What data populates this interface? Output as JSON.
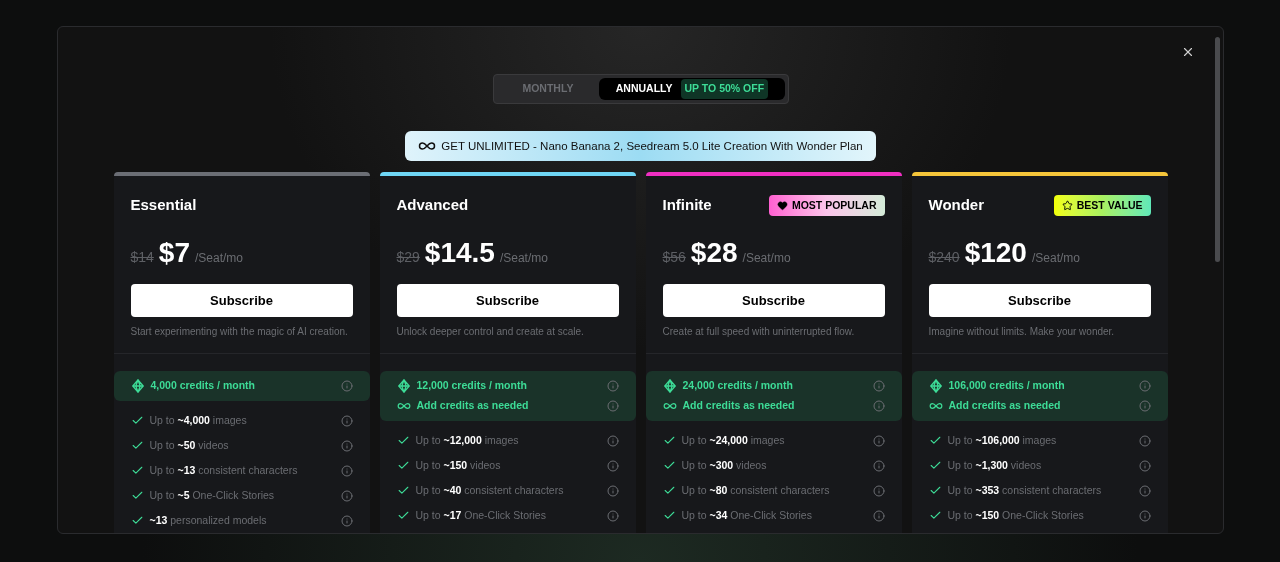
{
  "billing_toggle": {
    "options": [
      {
        "label": "MONTHLY",
        "selected": false
      },
      {
        "label": "ANNUALLY",
        "selected": true,
        "badge": "UP TO 50% OFF"
      }
    ]
  },
  "banner": {
    "text": "GET UNLIMITED - Nano Banana 2, Seedream 5.0 Lite Creation With Wonder Plan"
  },
  "plans": [
    {
      "name": "Essential",
      "color": "#6b6e75",
      "old_price": "$14",
      "price": "$7",
      "unit": "/Seat/mo",
      "button": "Subscribe",
      "description": "Start experimenting with the magic of AI creation.",
      "credits": [
        {
          "kind": "diamond",
          "text": "4,000 credits / month"
        }
      ],
      "features": [
        "Up to **~4,000** images",
        "Up to **~50** videos",
        "Up to **~13** consistent characters",
        "Up to **~5** One-Click Stories",
        "**~13** personalized models"
      ]
    },
    {
      "name": "Advanced",
      "color": "#6fd6f5",
      "old_price": "$29",
      "price": "$14.5",
      "unit": "/Seat/mo",
      "button": "Subscribe",
      "description": "Unlock deeper control and create at scale.",
      "credits": [
        {
          "kind": "diamond",
          "text": "12,000 credits / month"
        },
        {
          "kind": "infinity",
          "text": "Add credits as needed"
        }
      ],
      "features": [
        "Up to **~12,000** images",
        "Up to **~150** videos",
        "Up to **~40** consistent characters",
        "Up to **~17** One-Click Stories"
      ]
    },
    {
      "name": "Infinite",
      "color": "#f02fc2",
      "old_price": "$56",
      "price": "$28",
      "unit": "/Seat/mo",
      "button": "Subscribe",
      "description": "Create at full speed with uninterrupted flow.",
      "badge": {
        "kind": "heart",
        "text": "MOST POPULAR"
      },
      "credits": [
        {
          "kind": "diamond",
          "text": "24,000 credits / month"
        },
        {
          "kind": "infinity",
          "text": "Add credits as needed"
        }
      ],
      "features": [
        "Up to **~24,000** images",
        "Up to **~300** videos",
        "Up to **~80** consistent characters",
        "Up to **~34** One-Click Stories"
      ]
    },
    {
      "name": "Wonder",
      "color": "#f5c53a",
      "old_price": "$240",
      "price": "$120",
      "unit": "/Seat/mo",
      "button": "Subscribe",
      "description": "Imagine without limits. Make your wonder.",
      "badge": {
        "kind": "star",
        "text": "BEST VALUE"
      },
      "credits": [
        {
          "kind": "diamond",
          "text": "106,000 credits / month"
        },
        {
          "kind": "infinity",
          "text": "Add credits as needed"
        }
      ],
      "features": [
        "Up to **~106,000** images",
        "Up to **~1,300** videos",
        "Up to **~353** consistent characters",
        "Up to **~150** One-Click Stories"
      ]
    }
  ]
}
